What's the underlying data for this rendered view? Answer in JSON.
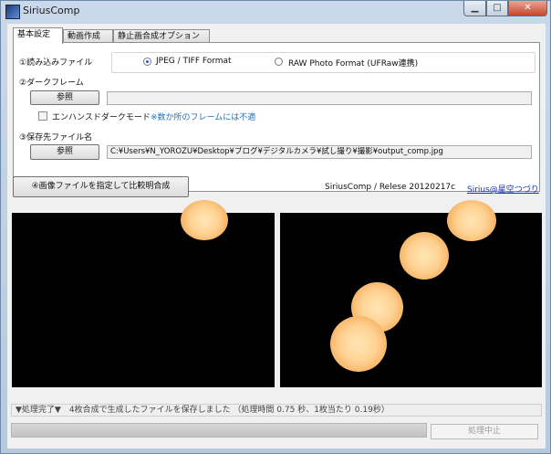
{
  "window": {
    "title": "SiriusComp"
  },
  "tabs": [
    {
      "label": "基本設定",
      "active": true
    },
    {
      "label": "動画作成",
      "active": false
    },
    {
      "label": "静止画合成オプション",
      "active": false
    }
  ],
  "input_section": {
    "label": "①読み込みファイル",
    "options": [
      {
        "label": "JPEG / TIFF Format",
        "selected": true
      },
      {
        "label": "RAW Photo Format (UFRaw連携)",
        "selected": false
      }
    ]
  },
  "dark_frame": {
    "label": "②ダークフレーム",
    "browse_label": "参照",
    "path": "",
    "enhanced_mode_label": "エンハンスドダークモード",
    "enhanced_mode_checked": false,
    "enhanced_note": "※数か所のフレームには不適"
  },
  "save_section": {
    "label": "③保存先ファイル名",
    "browse_label": "参照",
    "path": "C:¥Users¥N_YOROZU¥Desktop¥ブログ¥デジタルカメラ¥試し撮り¥撮影¥output_comp.jpg"
  },
  "action": {
    "compose_button": "④画像ファイルを指定して比較明合成",
    "version": "SiriusComp / Relese 20120217c",
    "author_link": "Sirius@星空つづり"
  },
  "status": {
    "text": "▼処理完了▼　4枚合成で生成したファイルを保存しました （処理時間 0.75 秒、1枚当たり 0.19秒）",
    "progress": 1.0,
    "stop_button": "処理中止"
  },
  "colors": {
    "preview_bg": "#000000",
    "link": "#1533b3",
    "note": "#1f6fb2"
  }
}
